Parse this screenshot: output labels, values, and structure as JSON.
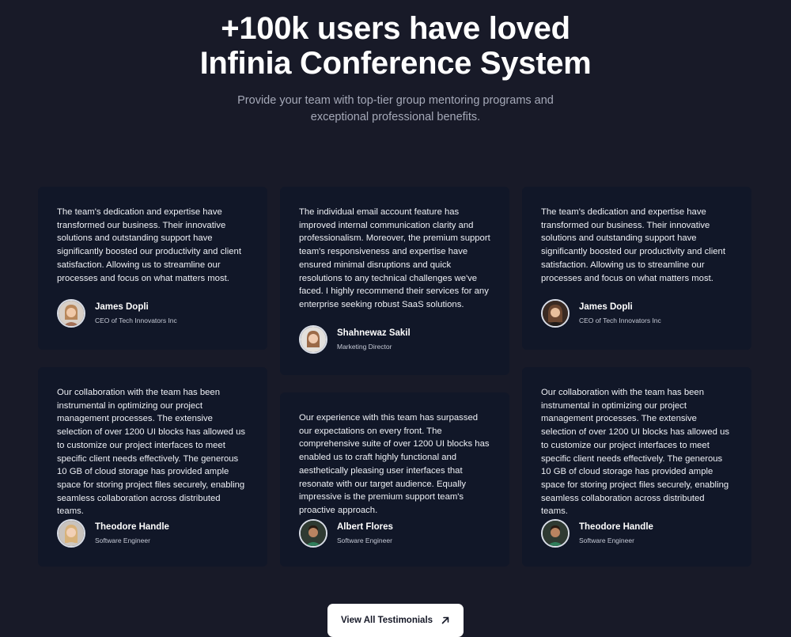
{
  "hero": {
    "title_line1": "+100k users have loved",
    "title_line2": "Infinia Conference System",
    "subtitle": "Provide your team with top-tier group mentoring programs and exceptional professional benefits."
  },
  "testimonials": [
    {
      "quote": "The team's dedication and expertise have transformed our business. Their innovative solutions and outstanding support have significantly boosted our productivity and client satisfaction. Allowing us to streamline our processes and focus on what matters most.",
      "name": "James Dopli",
      "role": "CEO of Tech Innovators Inc",
      "avatar": "woman-light-avatar"
    },
    {
      "quote": "The individual email account feature has improved internal communication clarity and professionalism. Moreover, the premium support team's responsiveness and expertise have ensured minimal disruptions and quick resolutions to any technical challenges we've faced. I highly recommend their services for any enterprise seeking robust SaaS solutions.",
      "name": "Shahnewaz Sakil",
      "role": "Marketing Director",
      "avatar": "woman-light-avatar"
    },
    {
      "quote": "The team's dedication and expertise have transformed our business. Their innovative solutions and outstanding support have significantly boosted our productivity and client satisfaction. Allowing us to streamline our processes and focus on what matters most.",
      "name": "James Dopli",
      "role": "CEO of Tech Innovators Inc",
      "avatar": "woman-dark-avatar"
    },
    {
      "quote": "Our collaboration with the team has been instrumental in optimizing our project management processes. The extensive selection of over 1200 UI blocks has allowed us to customize our project interfaces to meet specific client needs effectively. The generous 10 GB of cloud storage has provided ample space for storing project files securely, enabling seamless collaboration across distributed teams.",
      "name": "Theodore Handle",
      "role": "Software Engineer",
      "avatar": "woman-blonde-avatar"
    },
    {
      "quote": "Our experience with this team has surpassed our expectations on every front. The comprehensive suite of over 1200 UI blocks has enabled us to craft highly functional and aesthetically pleasing user interfaces that resonate with our target audience. Equally impressive is the premium support team's proactive approach.",
      "name": "Albert Flores",
      "role": "Software Engineer",
      "avatar": "man-green-shirt-avatar"
    },
    {
      "quote": "Our collaboration with the team has been instrumental in optimizing our project management processes. The extensive selection of over 1200 UI blocks has allowed us to customize our project interfaces to meet specific client needs effectively. The generous 10 GB of cloud storage has provided ample space for storing project files securely, enabling seamless collaboration across distributed teams.",
      "name": "Theodore Handle",
      "role": "Software Engineer",
      "avatar": "man-green-shirt-avatar"
    }
  ],
  "cta": {
    "label": "View All Testimonials",
    "icon": "arrow-up-right-icon"
  },
  "colors": {
    "background": "#181a28",
    "card": "#111728",
    "subtitle": "#a5a9b8",
    "button": "#ffffff",
    "button_text": "#141726"
  }
}
